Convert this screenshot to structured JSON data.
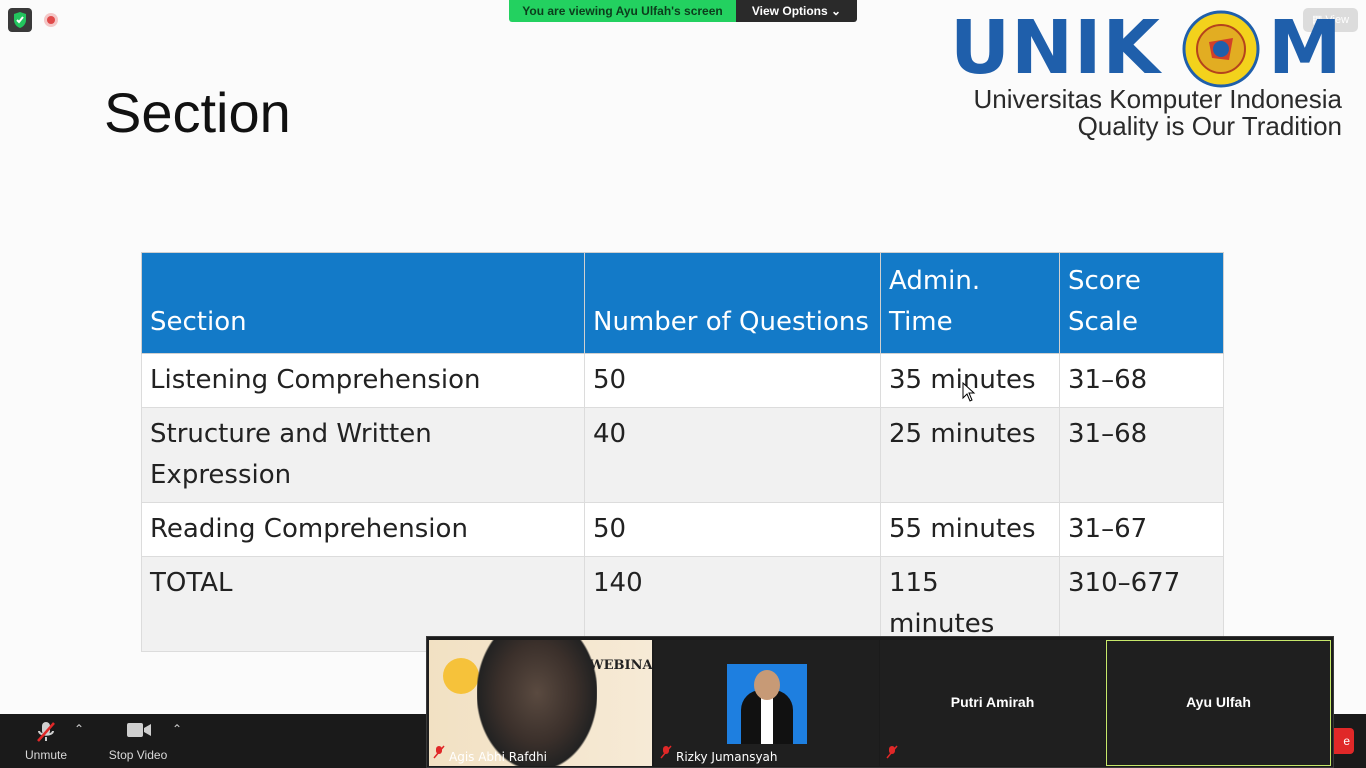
{
  "banner": {
    "viewing": "You are viewing Ayu Ulfah's screen",
    "view_options": "View Options"
  },
  "view_button": "View",
  "slide": {
    "title": "Section",
    "logo": {
      "word_left": "UNIK",
      "word_right": "M",
      "emblem_text_top": "UNIVERSITAS KOMPUTER INDONESIA",
      "emblem_text_bottom": "UNIKOM",
      "subtitle": "Universitas Komputer Indonesia",
      "tagline": "Quality is Our Tradition"
    },
    "table": {
      "headers": [
        "Section",
        "Number of Questions",
        "Admin. Time",
        "Score Scale"
      ],
      "rows": [
        [
          "Listening Comprehension",
          "50",
          "35 minutes",
          "31–68"
        ],
        [
          "Structure and Written Expression",
          "40",
          "25 minutes",
          "31–68"
        ],
        [
          "Reading Comprehension",
          "50",
          "55 minutes",
          "31–67"
        ],
        [
          "TOTAL",
          "140",
          "115 minutes",
          "310–677"
        ]
      ]
    }
  },
  "toolbar": {
    "unmute": "Unmute",
    "stop_video": "Stop Video",
    "leave": "e"
  },
  "gallery": {
    "participants": [
      {
        "name": "Agis Abhi Rafdhi",
        "muted": true,
        "poster_text": "WEBINAR"
      },
      {
        "name": "Rizky Jumansyah",
        "muted": true
      },
      {
        "name": "Putri Amirah",
        "muted": true
      },
      {
        "name": "Ayu Ulfah",
        "muted": false,
        "active": true
      }
    ]
  },
  "colors": {
    "table_header": "#137ac8",
    "brand_blue": "#1f5fab",
    "banner_green": "#23d160",
    "leave_red": "#e02828"
  }
}
